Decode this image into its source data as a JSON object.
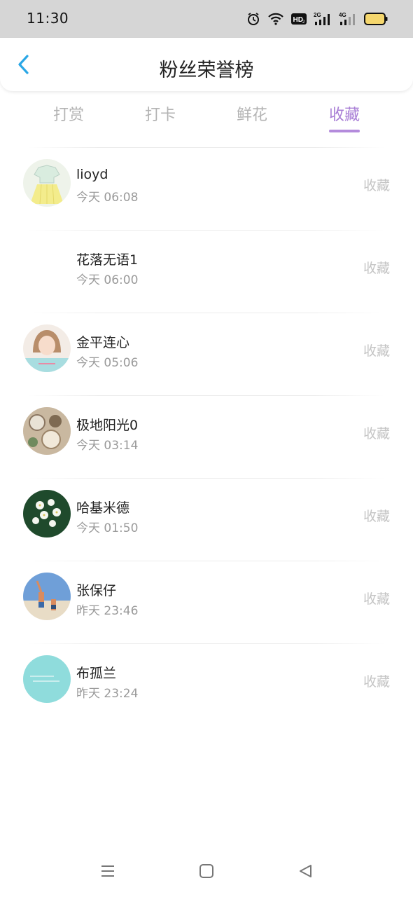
{
  "status_bar": {
    "time": "11:30",
    "icons": [
      "alarm-icon",
      "wifi-icon",
      "hd-icon",
      "signal-2g-icon",
      "signal-4g-icon",
      "battery-icon"
    ],
    "hd_label": "HD",
    "net1": "2G",
    "net2": "4G"
  },
  "header": {
    "title": "粉丝荣誉榜",
    "back_icon": "chevron-left-icon",
    "accent_color": "#2aa7e6"
  },
  "tabs": [
    {
      "label": "打赏",
      "active": false
    },
    {
      "label": "打卡",
      "active": false
    },
    {
      "label": "鲜花",
      "active": false
    },
    {
      "label": "收藏",
      "active": true
    }
  ],
  "active_color": "#a97fd6",
  "list": [
    {
      "name": "lioyd",
      "time": "今天 06:08",
      "action": "收藏",
      "avatar": "girl-dress-drawing"
    },
    {
      "name": "花落无语1",
      "time": "今天 06:00",
      "action": "收藏",
      "avatar": "none"
    },
    {
      "name": "金平连心",
      "time": "今天 05:06",
      "action": "收藏",
      "avatar": "girl-portrait"
    },
    {
      "name": "极地阳光0",
      "time": "今天 03:14",
      "action": "收藏",
      "avatar": "food-table"
    },
    {
      "name": "哈基米德",
      "time": "今天 01:50",
      "action": "收藏",
      "avatar": "white-flowers"
    },
    {
      "name": "张保仔",
      "time": "昨天 23:46",
      "action": "收藏",
      "avatar": "beach-people"
    },
    {
      "name": "布孤兰",
      "time": "昨天 23:24",
      "action": "收藏",
      "avatar": "teal-text-card"
    }
  ],
  "nav_bar": {
    "icons": [
      "menu-icon",
      "home-icon",
      "back-triangle-icon"
    ]
  }
}
